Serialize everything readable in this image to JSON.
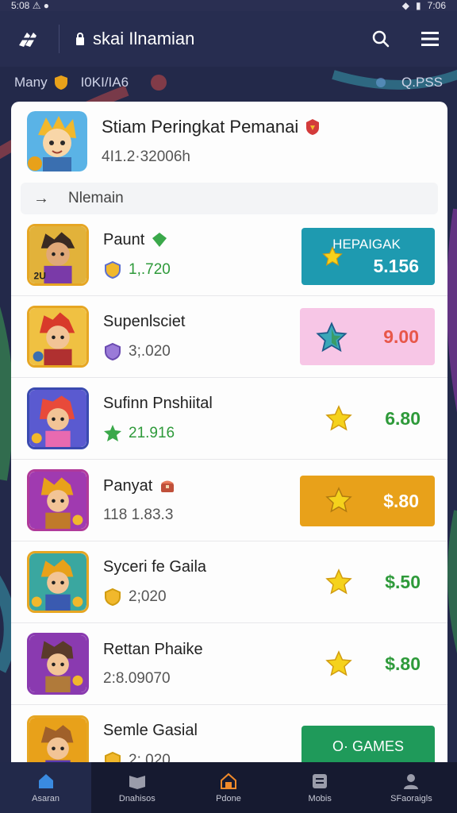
{
  "status": {
    "time_left": "5:08 ⚠ ●",
    "time_right": "7:06"
  },
  "appbar": {
    "title": "skai Ilnamian"
  },
  "subrow": {
    "left_label": "Many",
    "middle_label": "I0KI/IA6",
    "right_label": "Q.PSS"
  },
  "header": {
    "title": "Stiam Peringkat Pemanai",
    "subtitle": "4I1.2·32006h"
  },
  "subhead": {
    "arrow": "→",
    "label": "Nlemain"
  },
  "rows": [
    {
      "name": "Paunt",
      "meta": "1,.720",
      "score_label": "HEPAIGAK",
      "score": "5.156"
    },
    {
      "name": "Supenlsciet",
      "meta": "3;.020",
      "score": "9.00"
    },
    {
      "name": "Sufinn Pnshiital",
      "meta": "21.916",
      "score": "6.80"
    },
    {
      "name": "Panyat",
      "meta": "118 1.83.3",
      "score": "$.80"
    },
    {
      "name": "Syceri fe Gaila",
      "meta": "2;020",
      "score": "$.50"
    },
    {
      "name": "Rettan Phaike",
      "meta": "2:8.09070",
      "score": "$.80"
    },
    {
      "name": "Semle Gasial",
      "meta": "2:.020",
      "score": "O· GAMES"
    }
  ],
  "nav": [
    {
      "label": "Asaran"
    },
    {
      "label": "Dnahisos"
    },
    {
      "label": "Pdone"
    },
    {
      "label": "Mobis"
    },
    {
      "label": "SFaoraigls"
    }
  ],
  "colors": {
    "appbar": "#272d50",
    "teal": "#1e9ab0",
    "pink": "#f7c6e6",
    "orange": "#e8a11a",
    "green": "#1f9a5a",
    "score_green": "#2e9a3a",
    "score_red": "#e8574a"
  }
}
